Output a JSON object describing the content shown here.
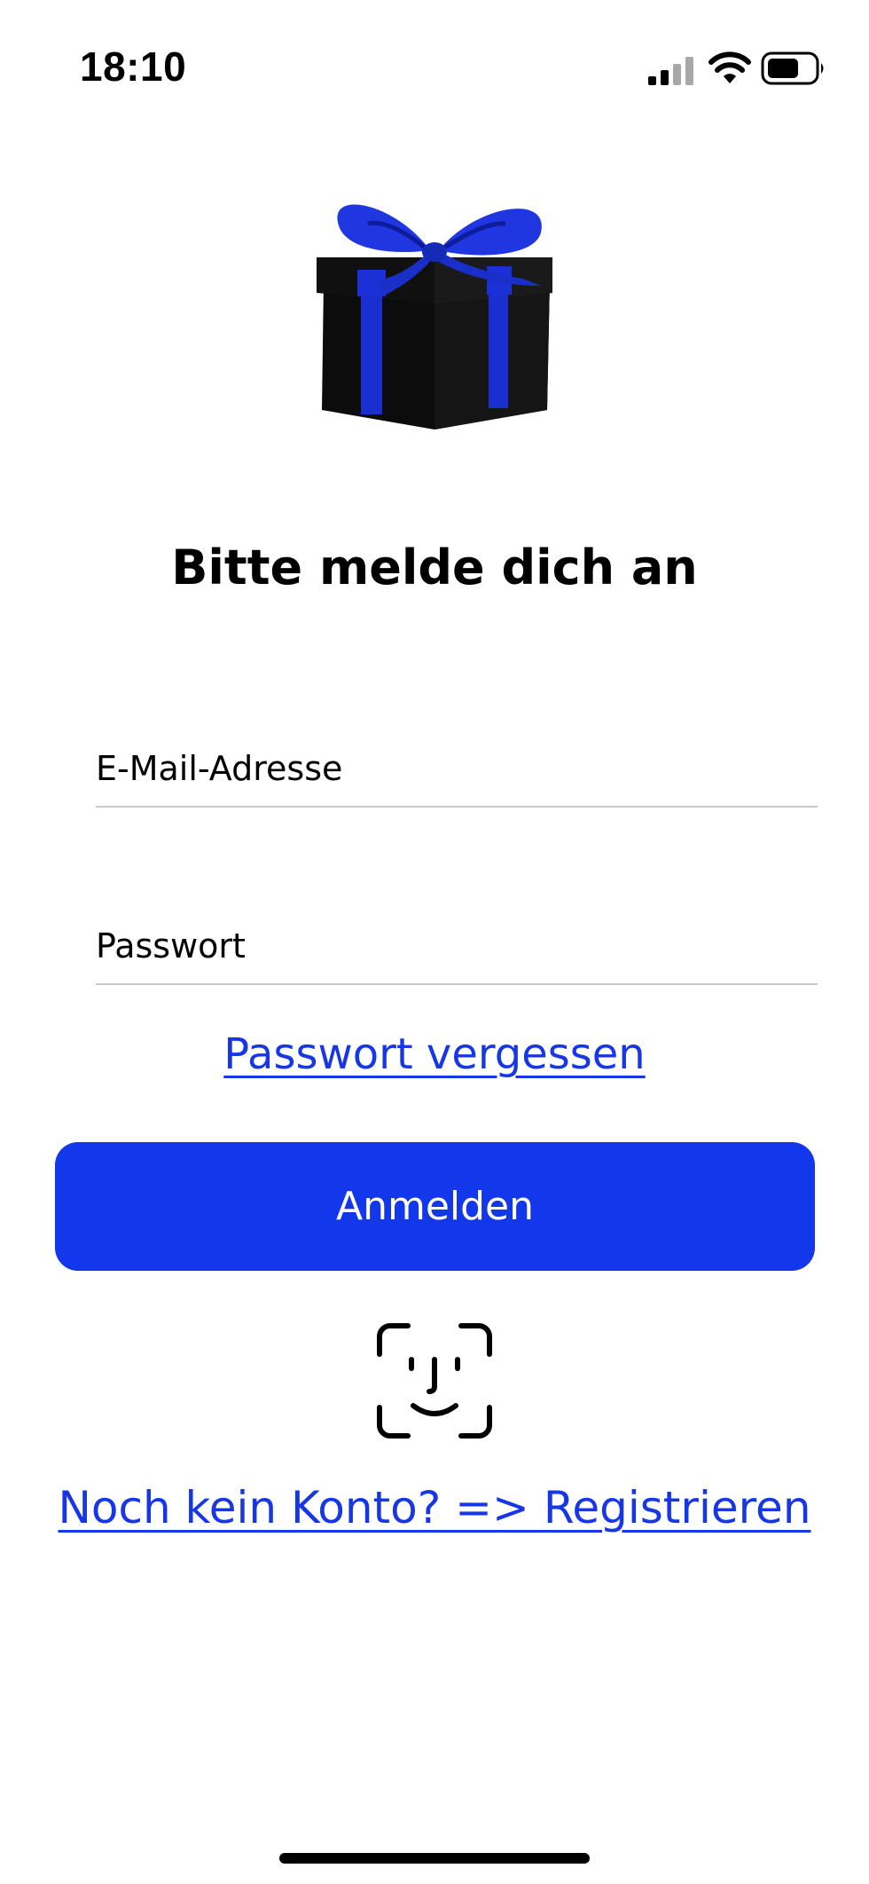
{
  "status_bar": {
    "time": "18:10",
    "icons": [
      "signal-icon",
      "wifi-icon",
      "battery-icon"
    ]
  },
  "header": {
    "image": "gift-box-image",
    "title": "Bitte melde dich an"
  },
  "form": {
    "email_placeholder": "E-Mail-Adresse",
    "email_value": "",
    "password_placeholder": "Passwort",
    "password_value": ""
  },
  "links": {
    "forgot_password": "Passwort vergessen",
    "register": "Noch kein Konto? => Registrieren"
  },
  "actions": {
    "login_label": "Anmelden",
    "biometric_icon": "face-id-icon"
  },
  "colors": {
    "accent": "#1337ea",
    "link": "#1737e6",
    "text": "#000000",
    "background": "#ffffff",
    "divider": "#c9c9c9"
  }
}
